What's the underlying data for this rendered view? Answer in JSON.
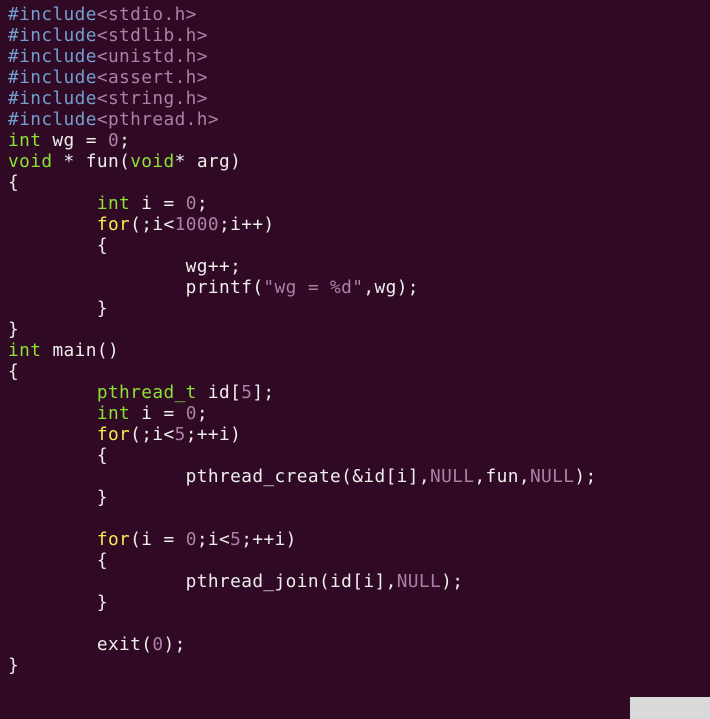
{
  "code": {
    "lines": [
      [
        {
          "cls": "tk-preproc",
          "text": "#include"
        },
        {
          "cls": "tk-include",
          "text": "<stdio.h>"
        }
      ],
      [
        {
          "cls": "tk-preproc",
          "text": "#include"
        },
        {
          "cls": "tk-include",
          "text": "<stdlib.h>"
        }
      ],
      [
        {
          "cls": "tk-preproc",
          "text": "#include"
        },
        {
          "cls": "tk-include",
          "text": "<unistd.h>"
        }
      ],
      [
        {
          "cls": "tk-preproc",
          "text": "#include"
        },
        {
          "cls": "tk-include",
          "text": "<assert.h>"
        }
      ],
      [
        {
          "cls": "tk-preproc",
          "text": "#include"
        },
        {
          "cls": "tk-include",
          "text": "<string.h>"
        }
      ],
      [
        {
          "cls": "tk-preproc",
          "text": "#include"
        },
        {
          "cls": "tk-include",
          "text": "<pthread.h>"
        }
      ],
      [
        {
          "cls": "tk-type",
          "text": "int"
        },
        {
          "cls": "tk-ident",
          "text": " wg "
        },
        {
          "cls": "tk-op",
          "text": "= "
        },
        {
          "cls": "tk-number",
          "text": "0"
        },
        {
          "cls": "tk-punct",
          "text": ";"
        }
      ],
      [
        {
          "cls": "tk-type",
          "text": "void"
        },
        {
          "cls": "tk-punct",
          "text": " * "
        },
        {
          "cls": "tk-funcname",
          "text": "fun"
        },
        {
          "cls": "tk-punct",
          "text": "("
        },
        {
          "cls": "tk-type",
          "text": "void"
        },
        {
          "cls": "tk-punct",
          "text": "* "
        },
        {
          "cls": "tk-ident",
          "text": "arg"
        },
        {
          "cls": "tk-punct",
          "text": ")"
        }
      ],
      [
        {
          "cls": "tk-punct",
          "text": "{"
        }
      ],
      [
        {
          "cls": "tk-ident",
          "text": "        "
        },
        {
          "cls": "tk-type",
          "text": "int"
        },
        {
          "cls": "tk-ident",
          "text": " i "
        },
        {
          "cls": "tk-op",
          "text": "= "
        },
        {
          "cls": "tk-number",
          "text": "0"
        },
        {
          "cls": "tk-punct",
          "text": ";"
        }
      ],
      [
        {
          "cls": "tk-ident",
          "text": "        "
        },
        {
          "cls": "tk-kw",
          "text": "for"
        },
        {
          "cls": "tk-punct",
          "text": "(;i<"
        },
        {
          "cls": "tk-number",
          "text": "1000"
        },
        {
          "cls": "tk-punct",
          "text": ";i++)"
        }
      ],
      [
        {
          "cls": "tk-ident",
          "text": "        "
        },
        {
          "cls": "tk-punct",
          "text": "{"
        }
      ],
      [
        {
          "cls": "tk-ident",
          "text": "                wg++;"
        }
      ],
      [
        {
          "cls": "tk-ident",
          "text": "                printf("
        },
        {
          "cls": "tk-string",
          "text": "\"wg = %d\""
        },
        {
          "cls": "tk-ident",
          "text": ",wg);"
        }
      ],
      [
        {
          "cls": "tk-ident",
          "text": "        "
        },
        {
          "cls": "tk-punct",
          "text": "}"
        }
      ],
      [
        {
          "cls": "tk-punct",
          "text": "}"
        }
      ],
      [
        {
          "cls": "tk-type",
          "text": "int"
        },
        {
          "cls": "tk-ident",
          "text": " "
        },
        {
          "cls": "tk-funcname",
          "text": "main"
        },
        {
          "cls": "tk-punct",
          "text": "()"
        }
      ],
      [
        {
          "cls": "tk-punct",
          "text": "{"
        }
      ],
      [
        {
          "cls": "tk-ident",
          "text": "        "
        },
        {
          "cls": "tk-type",
          "text": "pthread_t"
        },
        {
          "cls": "tk-ident",
          "text": " id["
        },
        {
          "cls": "tk-number",
          "text": "5"
        },
        {
          "cls": "tk-ident",
          "text": "];"
        }
      ],
      [
        {
          "cls": "tk-ident",
          "text": "        "
        },
        {
          "cls": "tk-type",
          "text": "int"
        },
        {
          "cls": "tk-ident",
          "text": " i "
        },
        {
          "cls": "tk-op",
          "text": "= "
        },
        {
          "cls": "tk-number",
          "text": "0"
        },
        {
          "cls": "tk-punct",
          "text": ";"
        }
      ],
      [
        {
          "cls": "tk-ident",
          "text": "        "
        },
        {
          "cls": "tk-kw",
          "text": "for"
        },
        {
          "cls": "tk-punct",
          "text": "(;i<"
        },
        {
          "cls": "tk-number",
          "text": "5"
        },
        {
          "cls": "tk-punct",
          "text": ";++i)"
        }
      ],
      [
        {
          "cls": "tk-ident",
          "text": "        "
        },
        {
          "cls": "tk-punct",
          "text": "{"
        }
      ],
      [
        {
          "cls": "tk-ident",
          "text": "                pthread_create(&id[i],"
        },
        {
          "cls": "tk-number",
          "text": "NULL"
        },
        {
          "cls": "tk-ident",
          "text": ",fun,"
        },
        {
          "cls": "tk-number",
          "text": "NULL"
        },
        {
          "cls": "tk-ident",
          "text": ");"
        }
      ],
      [
        {
          "cls": "tk-ident",
          "text": "        "
        },
        {
          "cls": "tk-punct",
          "text": "}"
        }
      ],
      [
        {
          "cls": "tk-ident",
          "text": ""
        }
      ],
      [
        {
          "cls": "tk-ident",
          "text": "        "
        },
        {
          "cls": "tk-kw",
          "text": "for"
        },
        {
          "cls": "tk-punct",
          "text": "(i "
        },
        {
          "cls": "tk-op",
          "text": "= "
        },
        {
          "cls": "tk-number",
          "text": "0"
        },
        {
          "cls": "tk-punct",
          "text": ";i<"
        },
        {
          "cls": "tk-number",
          "text": "5"
        },
        {
          "cls": "tk-punct",
          "text": ";++i)"
        }
      ],
      [
        {
          "cls": "tk-ident",
          "text": "        "
        },
        {
          "cls": "tk-punct",
          "text": "{"
        }
      ],
      [
        {
          "cls": "tk-ident",
          "text": "                pthread_join(id[i],"
        },
        {
          "cls": "tk-number",
          "text": "NULL"
        },
        {
          "cls": "tk-ident",
          "text": ");"
        }
      ],
      [
        {
          "cls": "tk-ident",
          "text": "        "
        },
        {
          "cls": "tk-punct",
          "text": "}"
        }
      ],
      [
        {
          "cls": "tk-ident",
          "text": ""
        }
      ],
      [
        {
          "cls": "tk-ident",
          "text": "        exit("
        },
        {
          "cls": "tk-number",
          "text": "0"
        },
        {
          "cls": "tk-ident",
          "text": ");"
        }
      ],
      [
        {
          "cls": "tk-punct",
          "text": "}"
        }
      ]
    ]
  }
}
